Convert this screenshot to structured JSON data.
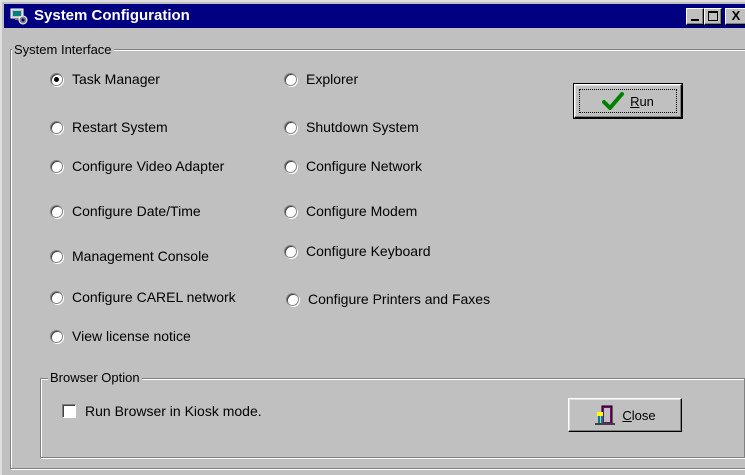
{
  "window": {
    "title": "System Configuration",
    "controls": {
      "minimize": "_",
      "maximize": "□",
      "close": "X"
    },
    "title_icon": "system-config-icon"
  },
  "system_interface": {
    "label": "System Interface",
    "options": [
      {
        "label": "Task Manager",
        "checked": true
      },
      {
        "label": "Explorer",
        "checked": false
      },
      {
        "label": "Restart System",
        "checked": false
      },
      {
        "label": "Shutdown System",
        "checked": false
      },
      {
        "label": "Configure Video Adapter",
        "checked": false
      },
      {
        "label": "Configure Network",
        "checked": false
      },
      {
        "label": "Configure Date/Time",
        "checked": false
      },
      {
        "label": "Configure Modem",
        "checked": false
      },
      {
        "label": "Management Console",
        "checked": false
      },
      {
        "label": "Configure Keyboard",
        "checked": false
      },
      {
        "label": "Configure CAREL network",
        "checked": false
      },
      {
        "label": "Configure Printers and Faxes",
        "checked": false
      },
      {
        "label": "View license notice",
        "checked": false
      }
    ]
  },
  "run_button": {
    "mnemonic": "R",
    "rest": "un",
    "icon": "checkmark-icon",
    "icon_color": "#008000"
  },
  "browser_option": {
    "label": "Browser Option",
    "kiosk_checkbox": {
      "label": "Run Browser  in Kiosk mode.",
      "checked": false
    }
  },
  "close_button": {
    "mnemonic": "C",
    "rest": "lose",
    "icon": "door-exit-icon"
  }
}
